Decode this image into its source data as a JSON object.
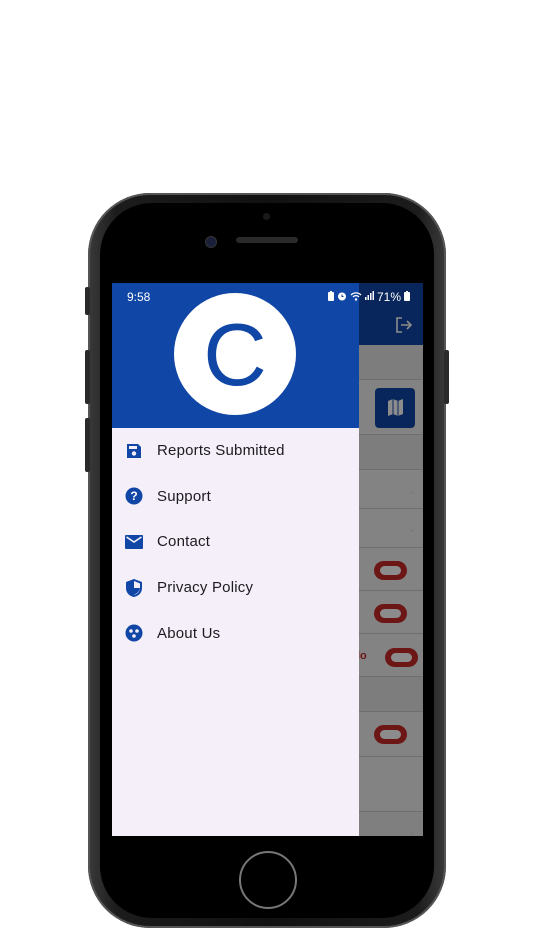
{
  "status_bar": {
    "time": "9:58",
    "battery": "71%"
  },
  "drawer": {
    "avatar_letter": "C",
    "items": [
      {
        "label": "Reports Submitted",
        "icon": "save-icon"
      },
      {
        "label": "Support",
        "icon": "help-icon"
      },
      {
        "label": "Contact",
        "icon": "mail-icon"
      },
      {
        "label": "Privacy Policy",
        "icon": "shield-icon"
      },
      {
        "label": "About Us",
        "icon": "group-icon"
      }
    ]
  },
  "background_app": {
    "partial_text": "lo"
  },
  "colors": {
    "primary": "#1046a6",
    "drawer_bg": "#f4eff8",
    "toggle": "#c62828"
  }
}
